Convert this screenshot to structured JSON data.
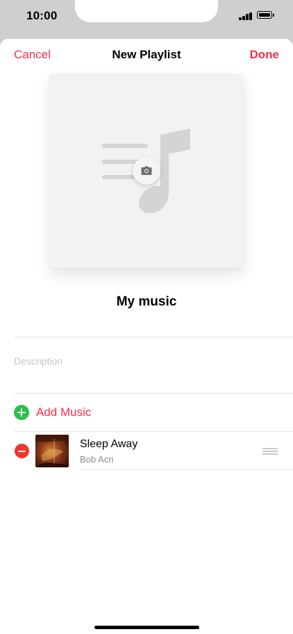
{
  "status_bar": {
    "time": "10:00"
  },
  "nav": {
    "cancel_label": "Cancel",
    "title": "New Playlist",
    "done_label": "Done"
  },
  "playlist": {
    "name": "My music",
    "description_placeholder": "Description"
  },
  "add_music": {
    "label": "Add Music"
  },
  "songs": [
    {
      "title": "Sleep Away",
      "artist": "Bob Acri"
    }
  ],
  "colors": {
    "accent": "#fa2d48",
    "add_green": "#2fbf4c",
    "remove_red": "#f0352b"
  },
  "icons": {
    "camera": "camera-icon",
    "placeholder_art": "music-note-list-icon",
    "add": "plus-circle-icon",
    "remove": "minus-circle-icon",
    "reorder": "reorder-handle-icon"
  }
}
